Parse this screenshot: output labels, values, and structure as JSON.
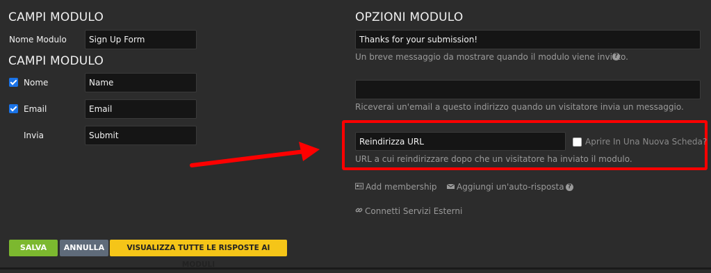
{
  "left": {
    "title1": "CAMPI MODULO",
    "name_label": "Nome Modulo",
    "name_value": "Sign Up Form",
    "title2": "CAMPI MODULO",
    "fields": [
      {
        "checked": true,
        "label": "Nome",
        "value": "Name"
      },
      {
        "checked": true,
        "label": "Email",
        "value": "Email"
      },
      {
        "checked": false,
        "label": "Invia",
        "value": "Submit"
      }
    ]
  },
  "right": {
    "title": "OPZIONI MODULO",
    "message_value": "Thanks for your submission!",
    "message_help": "Un breve messaggio da mostrare quando il modulo viene inviato.",
    "email_value": "",
    "email_help": "Riceverai un'email a questo indirizzo quando un visitatore invia un messaggio.",
    "redirect_value": "Reindirizza URL",
    "new_tab_label": "Aprire In Una Nuova Scheda?",
    "redirect_help": "URL a cui reindirizzare dopo che un visitatore ha inviato il modulo.",
    "add_membership": "Add membership",
    "autoresponder": "Aggiungi un'auto-risposta",
    "external_services": "Connetti Servizi Esterni"
  },
  "buttons": {
    "save": "SALVA",
    "cancel": "ANNULLA",
    "view_responses": "VISUALIZZA TUTTE LE RISPOSTE AI MODULI"
  },
  "colors": {
    "background": "#2c2c2c",
    "highlight": "#ff0000",
    "save": "#7cb82f",
    "cancel": "#5f6b7a",
    "view": "#f5c518"
  }
}
